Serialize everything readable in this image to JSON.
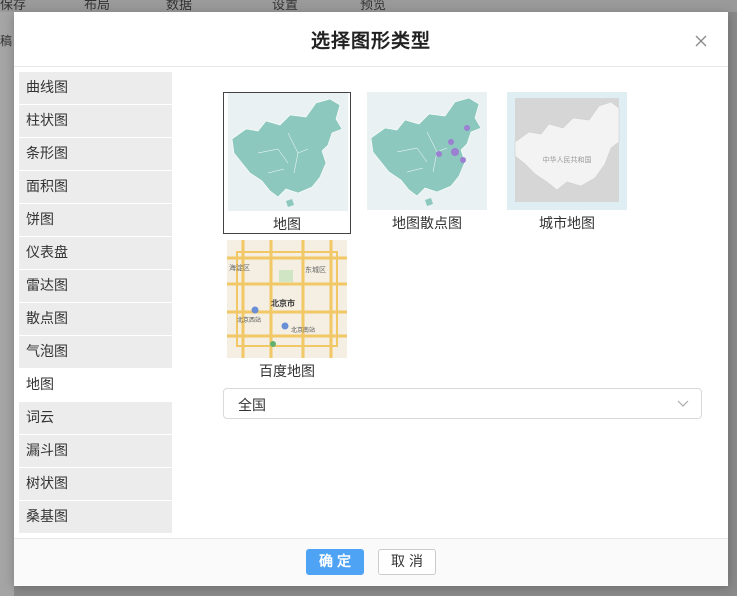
{
  "background": {
    "toolbar_items": [
      "保存",
      "布局",
      "数据",
      "设置",
      "预览"
    ],
    "left_label": "稿"
  },
  "dialog": {
    "title": "选择图形类型",
    "chart_types": [
      "曲线图",
      "柱状图",
      "条形图",
      "面积图",
      "饼图",
      "仪表盘",
      "雷达图",
      "散点图",
      "气泡图",
      "地图",
      "词云",
      "漏斗图",
      "树状图",
      "桑基图"
    ],
    "active_type": "地图",
    "map_options": [
      {
        "label": "地图",
        "icon": "china-map-icon",
        "selected": true
      },
      {
        "label": "地图散点图",
        "icon": "china-scatter-map-icon",
        "selected": false
      },
      {
        "label": "城市地图",
        "icon": "city-map-icon",
        "selected": false
      },
      {
        "label": "百度地图",
        "icon": "baidu-map-icon",
        "selected": false
      }
    ],
    "region_select": {
      "value": "全国"
    },
    "city_map_caption": "中华人民共和国",
    "baidu_map_labels": {
      "city": "北京市",
      "district1": "东城区",
      "district2": "海淀区",
      "station1": "北京西站",
      "station2": "北京南站"
    },
    "confirm_label": "确定",
    "cancel_label": "取消"
  },
  "colors": {
    "accent": "#4ea3f5",
    "map_fill": "#8cc8bd",
    "map_bg": "#e9f1f2",
    "scatter_dot": "#9b7fd1"
  }
}
